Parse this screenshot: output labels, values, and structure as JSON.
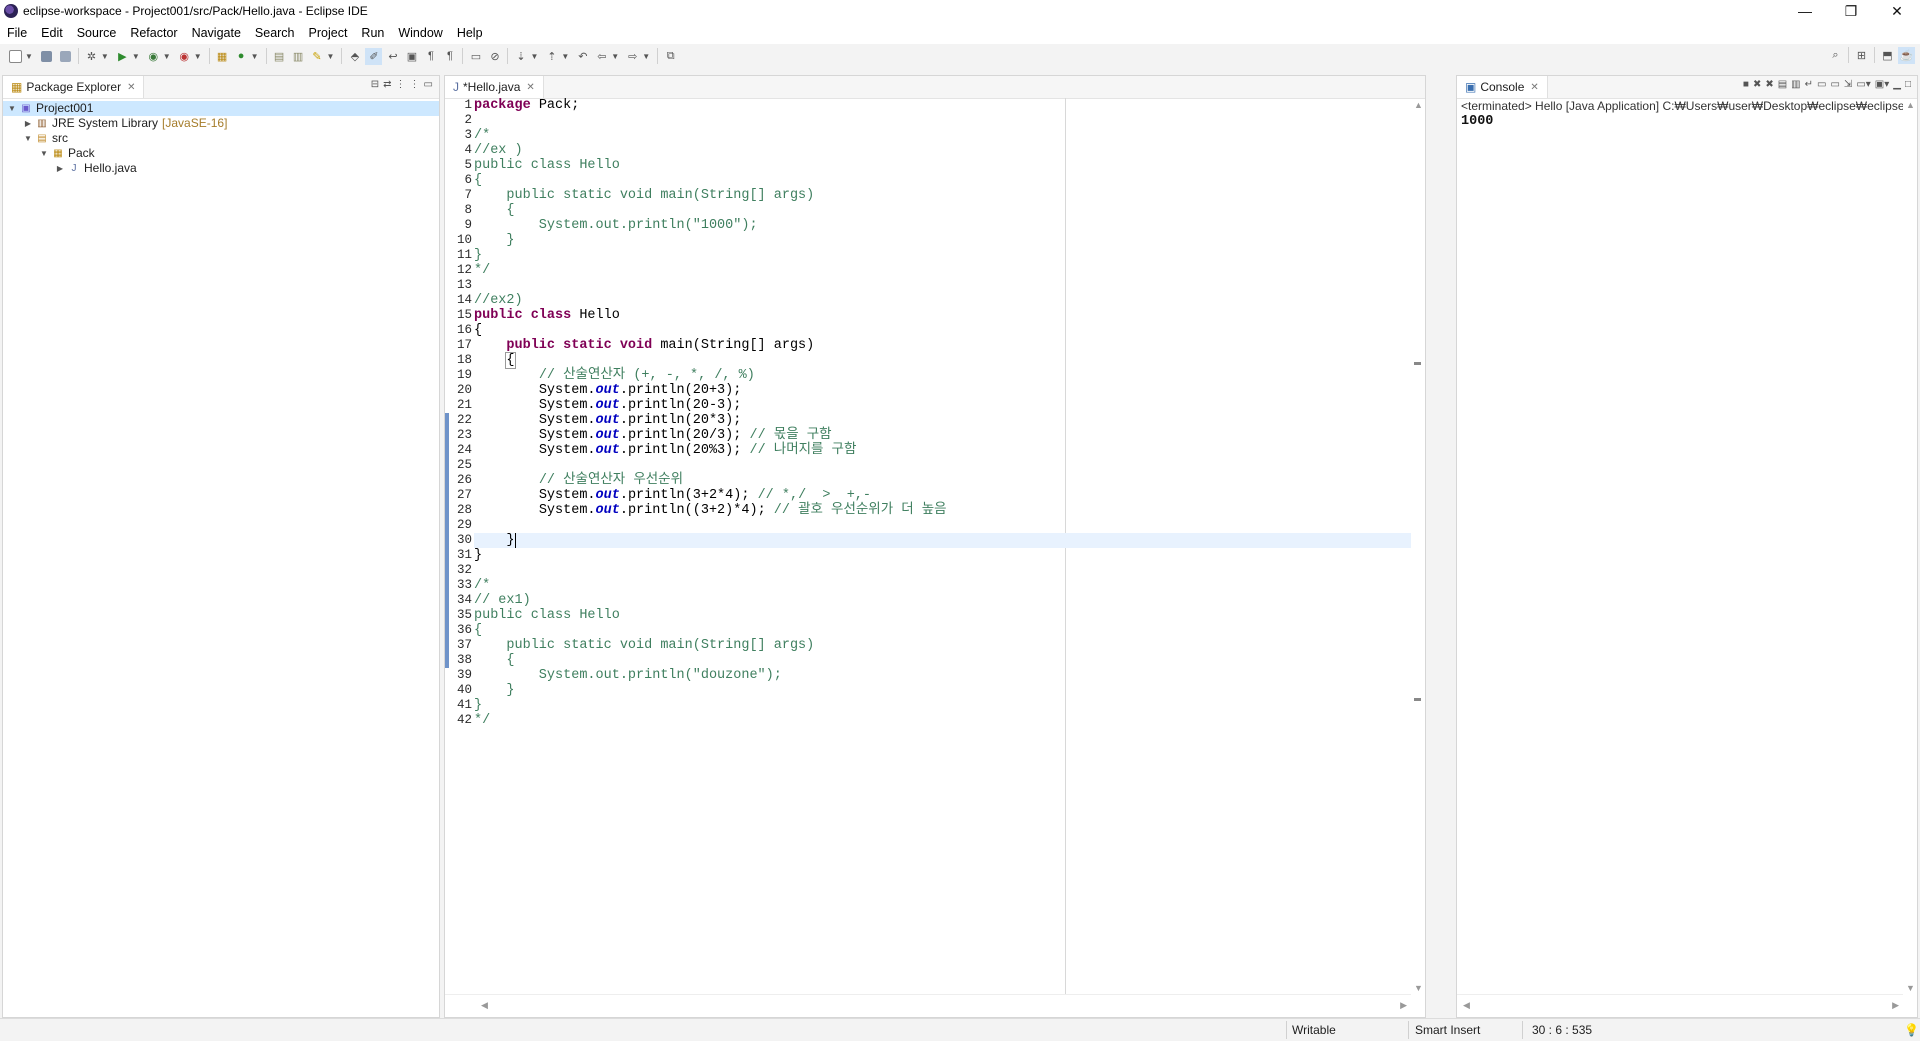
{
  "window": {
    "title": "eclipse-workspace - Project001/src/Pack/Hello.java - Eclipse IDE",
    "minimize": "—",
    "restore": "❐",
    "close": "✕"
  },
  "menu": [
    "File",
    "Edit",
    "Source",
    "Refactor",
    "Navigate",
    "Search",
    "Project",
    "Run",
    "Window",
    "Help"
  ],
  "package_explorer": {
    "tab_label": "Package Explorer",
    "tree": {
      "project": "Project001",
      "jre": "JRE System Library",
      "jre_version": "[JavaSE-16]",
      "src": "src",
      "package": "Pack",
      "file": "Hello.java"
    }
  },
  "editor": {
    "tab_label": "*Hello.java",
    "line_numbers": [
      "1",
      "2",
      "3",
      "4",
      "5",
      "6",
      "7",
      "8",
      "9",
      "10",
      "11",
      "12",
      "13",
      "14",
      "15",
      "16",
      "17",
      "18",
      "19",
      "20",
      "21",
      "22",
      "23",
      "24",
      "25",
      "26",
      "27",
      "28",
      "29",
      "30",
      "31",
      "32",
      "33",
      "34",
      "35",
      "36",
      "37",
      "38",
      "39",
      "40",
      "41",
      "42"
    ],
    "code": {
      "l1_kw": "package",
      "l1_rest": " Pack;",
      "l3": "/*",
      "l4": "//ex )",
      "l5": "public class Hello",
      "l6": "{",
      "l7": "    public static void main(String[] args)",
      "l8": "    {",
      "l9": "        System.out.println(\"1000\");",
      "l10": "    }",
      "l11": "}",
      "l12": "*/",
      "l14": "//ex2)",
      "l15_kw": "public class",
      "l15_rest": " Hello",
      "l16": "{",
      "l17_kw": "public static void",
      "l17_rest": " main(String[] args)",
      "l18": "{",
      "l19": "// 산술연산자 (+, -, *, /, %)",
      "sys": "System.",
      "out": "out",
      "l20": ".println(20+3);",
      "l21": ".println(20-3);",
      "l22": ".println(20*3);",
      "l23": ".println(20/3); ",
      "l23_c": "// 몫을 구함",
      "l24": ".println(20%3); ",
      "l24_c": "// 나머지를 구함",
      "l26": "// 산술연산자 우선순위",
      "l27": ".println(3+2*4); ",
      "l27_c": "// *,/  >  +,-",
      "l28": ".println((3+2)*4); ",
      "l28_c": "// 괄호 우선순위가 더 높음",
      "l30": "}",
      "l31": "}",
      "l33": "/*",
      "l34": "// ex1)",
      "l35": "public class Hello",
      "l36": "{",
      "l37": "    public static void main(String[] args)",
      "l38": "    {",
      "l39": "        System.out.println(\"douzone\");",
      "l40": "    }",
      "l41": "}",
      "l42": "*/"
    }
  },
  "console": {
    "tab_label": "Console",
    "header": "<terminated> Hello [Java Application] C:₩Users₩user₩Desktop₩eclipse₩eclipse₩plu",
    "output": "1000"
  },
  "status": {
    "writable": "Writable",
    "insert_mode": "Smart Insert",
    "position": "30 : 6 : 535"
  }
}
